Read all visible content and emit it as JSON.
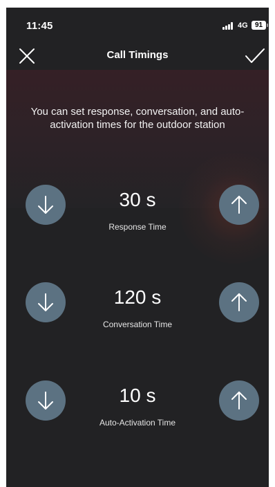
{
  "status_bar": {
    "time": "11:45",
    "network": "4G",
    "battery": "91"
  },
  "nav": {
    "title": "Call Timings",
    "close_icon": "close-icon",
    "confirm_icon": "checkmark-icon"
  },
  "description": "You can set response, conversation, and auto-activation times for the outdoor station",
  "timings": [
    {
      "value": "30 s",
      "label": "Response Time"
    },
    {
      "value": "120 s",
      "label": "Conversation Time"
    },
    {
      "value": "10 s",
      "label": "Auto-Activation Time"
    }
  ],
  "colors": {
    "background": "#222224",
    "button": "#5c7282",
    "header_tint": "#352026"
  },
  "icons": {
    "decrease": "arrow-down-icon",
    "increase": "arrow-up-icon"
  }
}
